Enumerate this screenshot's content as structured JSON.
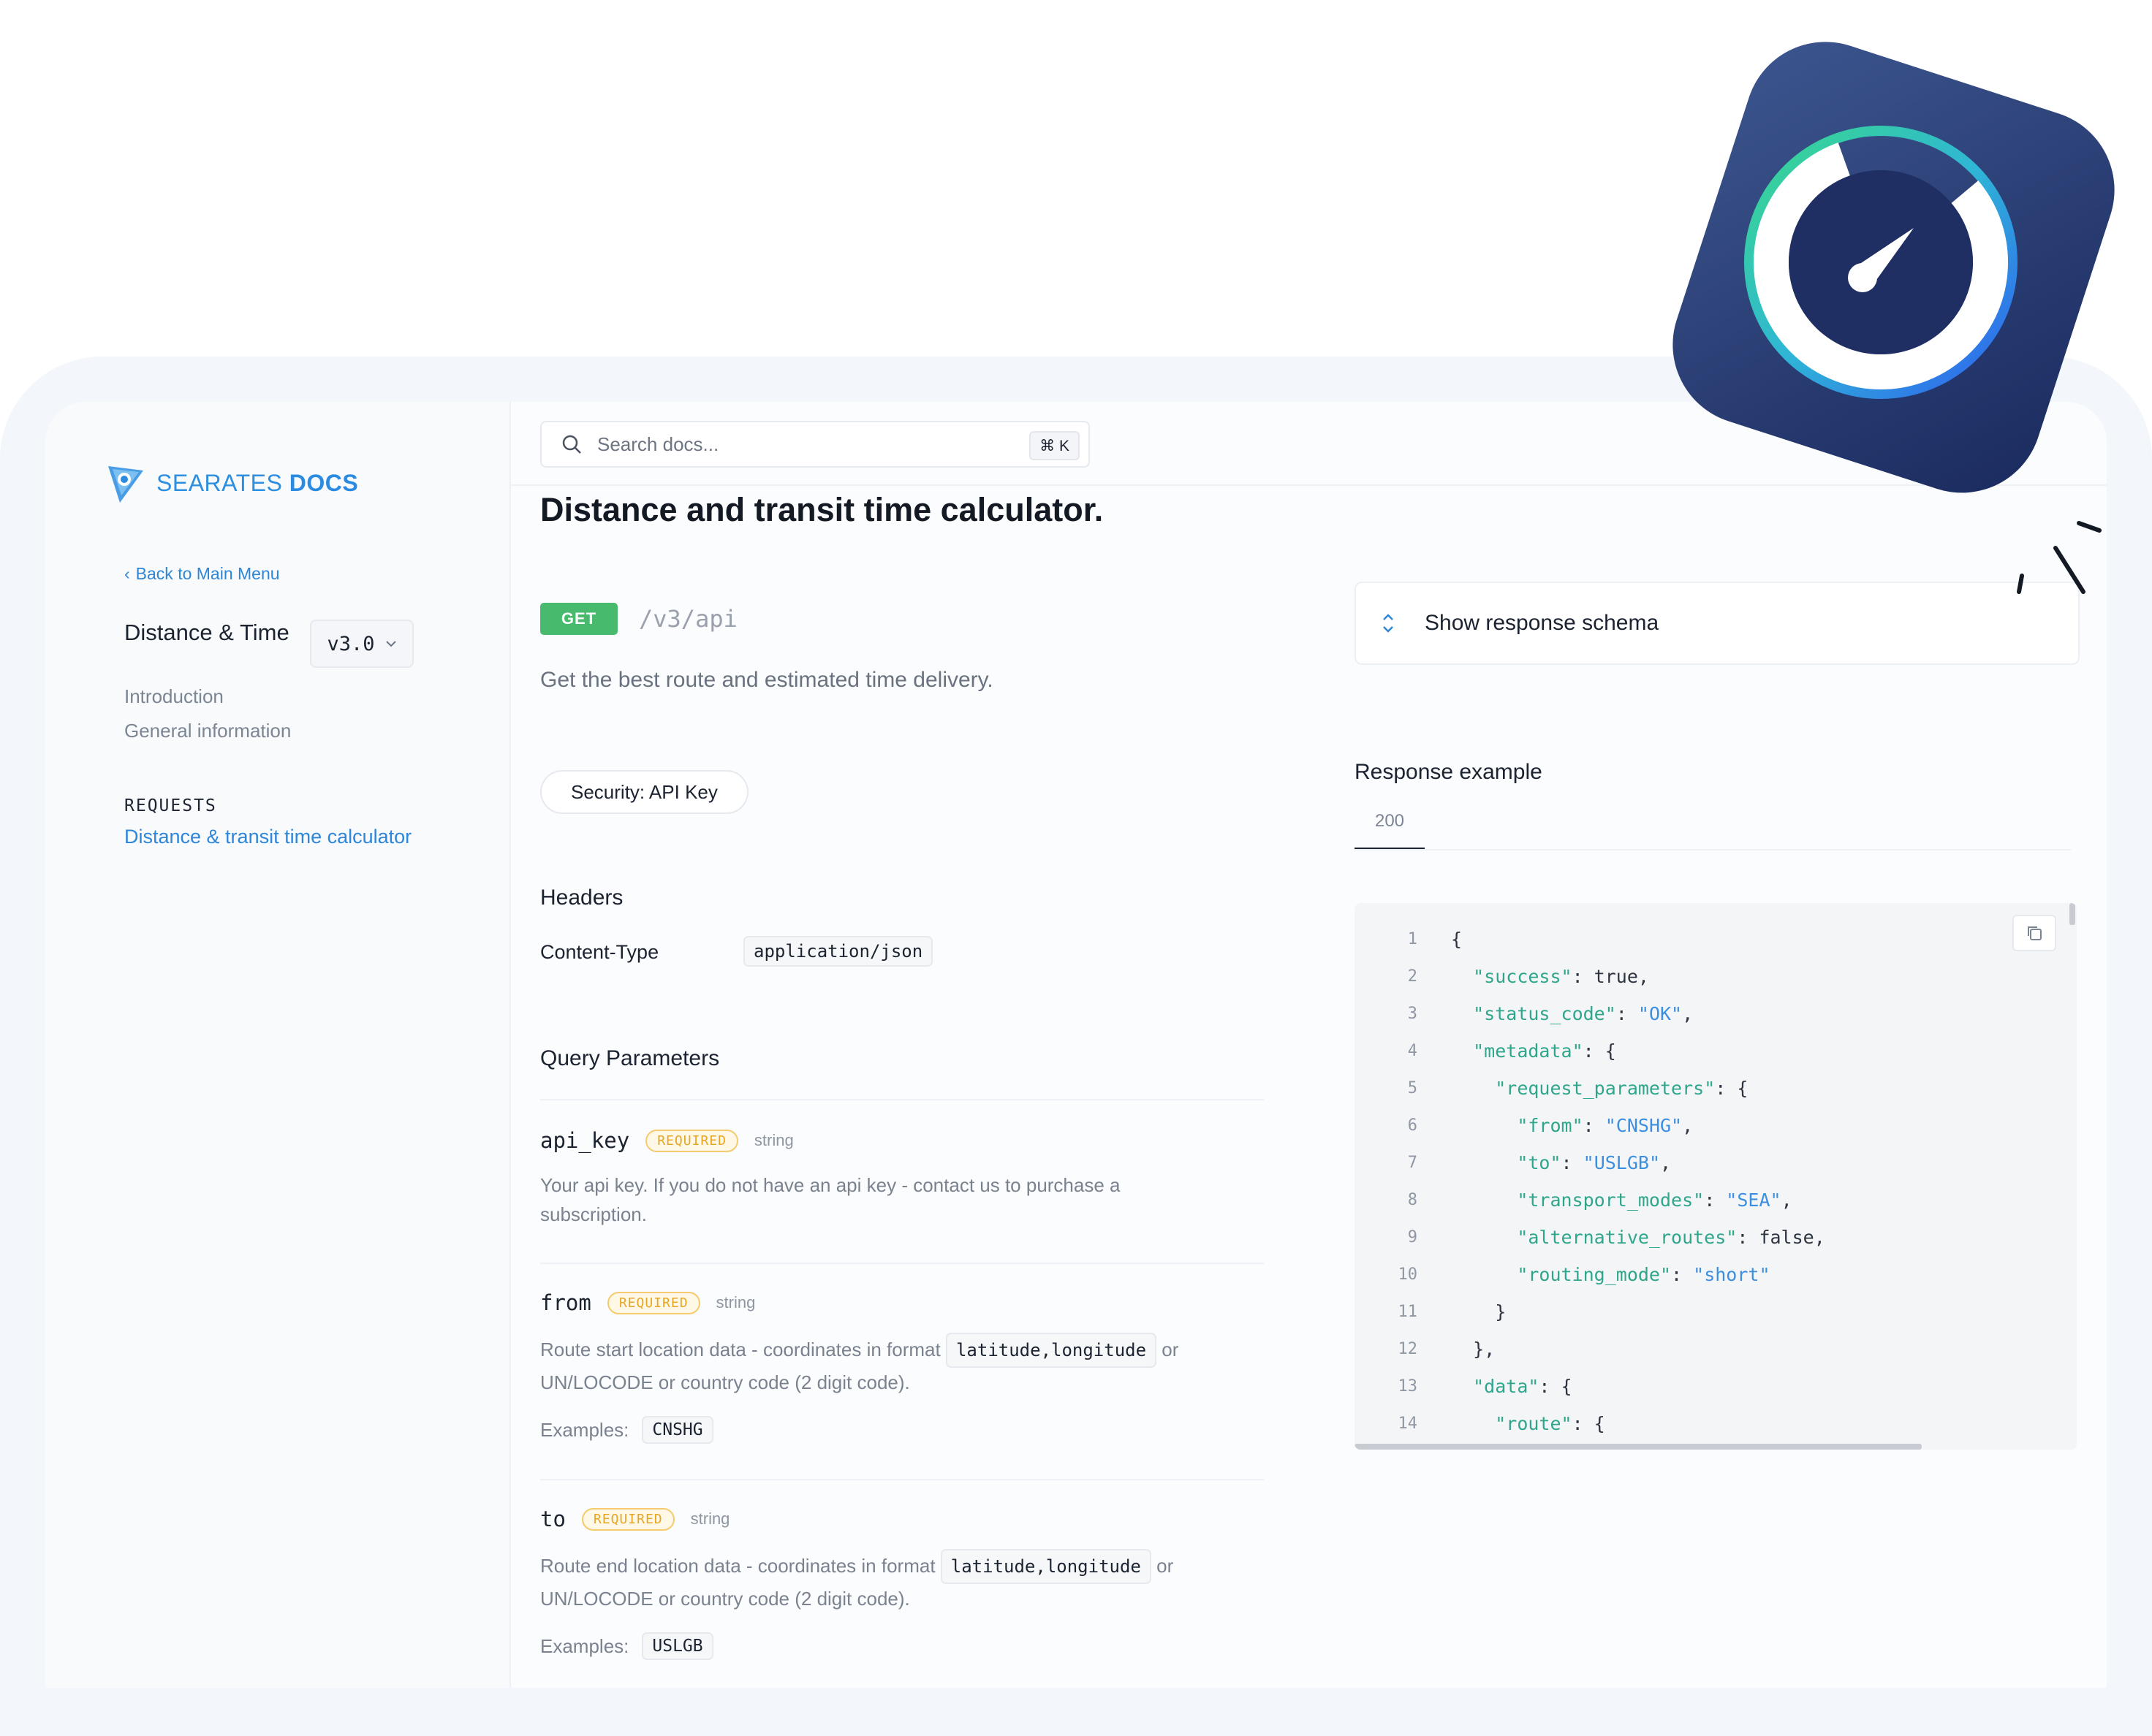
{
  "brand": {
    "name": "SEARATES",
    "suffix": "DOCS"
  },
  "sidebar": {
    "back_label": "Back to Main Menu",
    "product_title": "Distance & Time",
    "version": "v3.0",
    "nav_items": [
      {
        "label": "Introduction"
      },
      {
        "label": "General information"
      }
    ],
    "section_heading": "REQUESTS",
    "active_item": "Distance & transit time calculator"
  },
  "search": {
    "placeholder": "Search docs...",
    "shortcut": "⌘ K"
  },
  "endpoint": {
    "title": "Distance and transit time calculator.",
    "method": "GET",
    "path": "/v3/api",
    "description": "Get the best route and estimated time delivery.",
    "security": "Security: API Key"
  },
  "headers": {
    "heading": "Headers",
    "key": "Content-Type",
    "value": "application/json"
  },
  "query": {
    "heading": "Query Parameters",
    "params": [
      {
        "name": "api_key",
        "required": "REQUIRED",
        "type": "string",
        "description": "Your api key. If you do not have an api key - contact us to purchase a subscription."
      },
      {
        "name": "from",
        "required": "REQUIRED",
        "type": "string",
        "desc_pre": "Route start location data - coordinates in format",
        "desc_code": "latitude,longitude",
        "desc_post": "or UN/LOCODE or country code (2 digit code).",
        "examples_label": "Examples:",
        "example": "CNSHG"
      },
      {
        "name": "to",
        "required": "REQUIRED",
        "type": "string",
        "desc_pre": "Route end location data - coordinates in format",
        "desc_code": "latitude,longitude",
        "desc_post": "or UN/LOCODE or country code (2 digit code).",
        "examples_label": "Examples:",
        "example": "USLGB"
      }
    ]
  },
  "response": {
    "schema_toggle": "Show response schema",
    "example_title": "Response example",
    "tab": "200",
    "code_lines": [
      {
        "n": "1",
        "indent": 0,
        "parts": [
          [
            "p",
            "{"
          ]
        ]
      },
      {
        "n": "2",
        "indent": 1,
        "parts": [
          [
            "k",
            "\"success\""
          ],
          [
            "p",
            ": true,"
          ]
        ]
      },
      {
        "n": "3",
        "indent": 1,
        "parts": [
          [
            "k",
            "\"status_code\""
          ],
          [
            "p",
            ": "
          ],
          [
            "s",
            "\"OK\""
          ],
          [
            "p",
            ","
          ]
        ]
      },
      {
        "n": "4",
        "indent": 1,
        "parts": [
          [
            "k",
            "\"metadata\""
          ],
          [
            "p",
            ": {"
          ]
        ]
      },
      {
        "n": "5",
        "indent": 2,
        "parts": [
          [
            "k",
            "\"request_parameters\""
          ],
          [
            "p",
            ": {"
          ]
        ]
      },
      {
        "n": "6",
        "indent": 3,
        "parts": [
          [
            "k",
            "\"from\""
          ],
          [
            "p",
            ": "
          ],
          [
            "s",
            "\"CNSHG\""
          ],
          [
            "p",
            ","
          ]
        ]
      },
      {
        "n": "7",
        "indent": 3,
        "parts": [
          [
            "k",
            "\"to\""
          ],
          [
            "p",
            ": "
          ],
          [
            "s",
            "\"USLGB\""
          ],
          [
            "p",
            ","
          ]
        ]
      },
      {
        "n": "8",
        "indent": 3,
        "parts": [
          [
            "k",
            "\"transport_modes\""
          ],
          [
            "p",
            ": "
          ],
          [
            "s",
            "\"SEA\""
          ],
          [
            "p",
            ","
          ]
        ]
      },
      {
        "n": "9",
        "indent": 3,
        "parts": [
          [
            "k",
            "\"alternative_routes\""
          ],
          [
            "p",
            ": false,"
          ]
        ]
      },
      {
        "n": "10",
        "indent": 3,
        "parts": [
          [
            "k",
            "\"routing_mode\""
          ],
          [
            "p",
            ": "
          ],
          [
            "s",
            "\"short\""
          ]
        ]
      },
      {
        "n": "11",
        "indent": 2,
        "parts": [
          [
            "p",
            "}"
          ]
        ]
      },
      {
        "n": "12",
        "indent": 1,
        "parts": [
          [
            "p",
            "},"
          ]
        ]
      },
      {
        "n": "13",
        "indent": 1,
        "parts": [
          [
            "k",
            "\"data\""
          ],
          [
            "p",
            ": {"
          ]
        ]
      },
      {
        "n": "14",
        "indent": 2,
        "parts": [
          [
            "k",
            "\"route\""
          ],
          [
            "p",
            ": {"
          ]
        ]
      }
    ]
  },
  "colors": {
    "accent": "#2e86d8",
    "get_badge": "#47ba6d",
    "required": "#e6a623",
    "app_icon_bg": "#24356b"
  },
  "icons": [
    "logo-icon",
    "chevron-left-icon",
    "chevron-down-icon",
    "search-icon",
    "expand-collapse-icon",
    "copy-icon",
    "speedometer-app-icon"
  ]
}
